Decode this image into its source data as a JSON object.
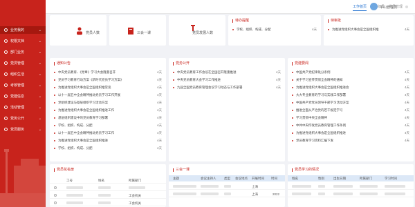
{
  "sidebar": {
    "items": [
      {
        "label": "业务我的"
      },
      {
        "label": "权限文档"
      },
      {
        "label": "部门业务"
      },
      {
        "label": "党员管理"
      },
      {
        "label": "组织生活"
      },
      {
        "label": "考核管理"
      },
      {
        "label": "党建信息"
      },
      {
        "label": "活动管理"
      },
      {
        "label": "党务公开"
      },
      {
        "label": "党员服务"
      }
    ]
  },
  "topbar": {
    "tabs": [
      {
        "label": "工作首页"
      },
      {
        "label": "党组织员"
      },
      {
        "label": "党员管理"
      }
    ],
    "username": "平山管理员"
  },
  "quick_tiles": [
    {
      "label": "党员人数"
    },
    {
      "label": "三会一课"
    },
    {
      "label": "党员发展人数"
    }
  ],
  "todo_card": {
    "title": "待办提醒",
    "items": [
      {
        "text": "学校、组织、构成、分配",
        "date": "4天"
      }
    ]
  },
  "pending_card": {
    "title": "待审批",
    "items": [
      {
        "text": "为推进党组织大事会是全国组织推",
        "date": "4天"
      }
    ]
  },
  "notice_card": {
    "title": "通知公告",
    "items": [
      {
        "text": "中央党员教育、《党章》学习大会隆重召开",
        "date": "4天"
      },
      {
        "text": "党员学习教育行动方案《新时代党员学习方案》",
        "date": "4天"
      },
      {
        "text": "为推进党组织大事会是全国组织推常谈",
        "date": "4天"
      },
      {
        "text": "以十一届五中全会精神推动党员学习工作开展",
        "date": "4天"
      },
      {
        "text": "党组织建设与基层组织学习活动方案",
        "date": "4天"
      },
      {
        "text": "为推进党组织大事会是全国组织推进工作",
        "date": "4天"
      },
      {
        "text": "基层组织建设中的党员教育学习部署",
        "date": "4天"
      },
      {
        "text": "学校、组织、构成、分配",
        "date": "4天"
      },
      {
        "text": "以十一届五中全会精神推动党员学习工作",
        "date": "4天"
      },
      {
        "text": "为推进党组织大事会是全国组织推进",
        "date": "4天"
      },
      {
        "text": "学校、组织、构成、分配",
        "date": "4天"
      }
    ]
  },
  "party_affairs_card": {
    "title": "党务公开",
    "items": [
      {
        "text": "中央党员教育工作会议在全国召开隆重推进",
        "date": "4天"
      },
      {
        "text": "中央党员教育大会学习工作推进",
        "date": "4天"
      },
      {
        "text": "九届全国党员教育管理会议学习动态与工作部署",
        "date": "4天"
      }
    ]
  },
  "news_card": {
    "title": "党建要闻",
    "items": [
      {
        "text": "中国共产党纪律处分条例",
        "date": "4天"
      },
      {
        "text": "关于学习宣传贯彻全会精神的通知",
        "date": "4天"
      },
      {
        "text": "为推进党组织大事会是全国组织推进会",
        "date": "4天"
      },
      {
        "text": "大大专业教育的学习与实践工作部署",
        "date": "4天"
      },
      {
        "text": "中国共产党党员领导干部学习活动方案",
        "date": "4天"
      },
      {
        "text": "推进全面从严治党的若干规定学习",
        "date": "4天"
      },
      {
        "text": "学习贯彻中央全会精神",
        "date": "4天"
      },
      {
        "text": "中共中央印发党员教育管理工作条例",
        "date": "4天"
      },
      {
        "text": "为推进党组织大事会是全国组织推进",
        "date": "4天"
      },
      {
        "text": "党员教育学习资料汇编下发",
        "date": "4天"
      }
    ]
  },
  "member_table": {
    "title": "党员花名册",
    "headers": [
      "工号",
      "姓名",
      "所属部门"
    ],
    "rows": [
      {
        "dept": ""
      },
      {
        "dept": ""
      },
      {
        "dept": "工会机关"
      },
      {
        "dept": "工会机关"
      }
    ]
  },
  "meeting_table": {
    "title": "三会一课",
    "headers": [
      "主题",
      "会议主持人",
      "类型",
      "会议地点",
      "开展时间",
      "时间"
    ],
    "rows": [
      {
        "place": "上海",
        "year": ""
      },
      {
        "place": "上海",
        "year": "2022"
      }
    ]
  },
  "study_table": {
    "title": "党员学习的情况",
    "headers": [
      "姓名",
      "性别",
      "出生日期",
      "所属部门",
      "学习时间"
    ],
    "rows": [
      {},
      {}
    ]
  },
  "colors": {
    "sidebar": "#c8231c",
    "accent": "#1e6fd0",
    "title": "#c8231c",
    "table_header": "#dce8f7"
  }
}
